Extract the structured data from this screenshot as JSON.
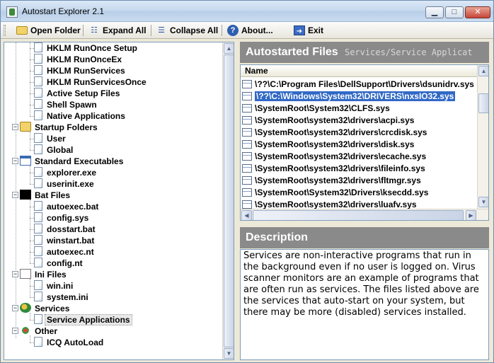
{
  "window": {
    "title": "Autostart Explorer 2.1",
    "buttons": {
      "minimize": "▁",
      "maximize": "□",
      "close": "✕"
    }
  },
  "toolbar": {
    "open_folder": "Open Folder",
    "expand_all": "Expand All",
    "collapse_all": "Collapse All",
    "about": "About...",
    "exit": "Exit"
  },
  "tree": {
    "registry_items": [
      "HKLM RunOnce Setup",
      "HKLM RunOnceEx",
      "HKLM RunServices",
      "HKLM RunServicesOnce",
      "Active Setup Files",
      "Shell Spawn",
      "Native Applications"
    ],
    "groups": [
      {
        "label": "Startup Folders",
        "icon": "folder-icon",
        "children": [
          "User",
          "Global"
        ]
      },
      {
        "label": "Standard Executables",
        "icon": "executable-icon",
        "children": [
          "explorer.exe",
          "userinit.exe"
        ]
      },
      {
        "label": "Bat Files",
        "icon": "console-icon",
        "children": [
          "autoexec.bat",
          "config.sys",
          "dosstart.bat",
          "winstart.bat",
          "autoexec.nt",
          "config.nt"
        ]
      },
      {
        "label": "Ini Files",
        "icon": "ini-file-icon",
        "children": [
          "win.ini",
          "system.ini"
        ]
      },
      {
        "label": "Services",
        "icon": "services-icon",
        "children": [
          "Service Applications"
        ]
      },
      {
        "label": "Other",
        "icon": "other-icon",
        "children": [
          "ICQ AutoLoad"
        ]
      }
    ],
    "selected": "Service Applications"
  },
  "autostarted": {
    "title": "Autostarted Files",
    "subtitle": "Services/Service Applicat",
    "column": "Name",
    "rows": [
      "\\??\\C:\\Program Files\\DellSupport\\Drivers\\dsunidrv.sys",
      "\\??\\C:\\Windows\\System32\\DRIVERS\\nxsIO32.sys",
      "\\SystemRoot\\System32\\CLFS.sys",
      "\\SystemRoot\\system32\\drivers\\acpi.sys",
      "\\SystemRoot\\system32\\drivers\\crcdisk.sys",
      "\\SystemRoot\\system32\\drivers\\disk.sys",
      "\\SystemRoot\\system32\\drivers\\ecache.sys",
      "\\SystemRoot\\system32\\drivers\\fileinfo.sys",
      "\\SystemRoot\\system32\\drivers\\fltmgr.sys",
      "\\SystemRoot\\System32\\Drivers\\ksecdd.sys",
      "\\SystemRoot\\system32\\drivers\\luafv.sys"
    ],
    "selected_index": 1
  },
  "description": {
    "title": "Description",
    "text": "Services are non-interactive programs that run in the background even if no user is logged on. Virus scanner monitors are an example of programs that are often run as services. The files listed above are the services that auto-start on your system, but there may be more (disabled) services installed."
  }
}
